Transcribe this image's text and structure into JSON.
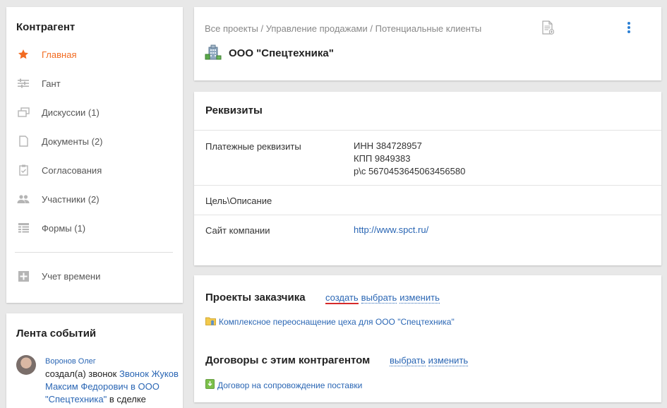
{
  "sidebar": {
    "title": "Контрагент",
    "items": [
      {
        "label": "Главная",
        "icon": "star-icon"
      },
      {
        "label": "Гант",
        "icon": "sliders-icon"
      },
      {
        "label": "Дискуссии (1)",
        "icon": "chat-icon"
      },
      {
        "label": "Документы (2)",
        "icon": "document-icon"
      },
      {
        "label": "Согласования",
        "icon": "clipboard-check-icon"
      },
      {
        "label": "Участники (2)",
        "icon": "people-icon"
      },
      {
        "label": "Формы (1)",
        "icon": "form-icon"
      },
      {
        "label": "Учет времени",
        "icon": "plus-box-icon"
      }
    ],
    "accent_color": "#f26b21"
  },
  "feed": {
    "title": "Лента событий",
    "author": "Воронов Олег",
    "text_prefix": "создал(а) звонок ",
    "link": "Звонок Жуков Максим Федорович в ООО \"Спецтехника\"",
    "text_suffix": " в сделке"
  },
  "header": {
    "breadcrumb": [
      "Все проекты",
      "Управление продажами",
      "Потенциальные клиенты"
    ],
    "separator": " / ",
    "title": "ООО \"Спецтехника\""
  },
  "requisites": {
    "title": "Реквизиты",
    "rows": [
      {
        "key": "Платежные реквизиты",
        "lines": [
          "ИНН 384728957",
          "КПП 9849383",
          "р\\с 5670453645063456580"
        ]
      },
      {
        "key": "Цель\\Описание",
        "lines": []
      },
      {
        "key": "Сайт компании",
        "link": "http://www.spct.ru/"
      }
    ]
  },
  "projects": {
    "title": "Проекты заказчика",
    "actions": [
      "создать",
      "выбрать",
      "изменить"
    ],
    "item": "Комплексное переоснащение цеха для ООО \"Спецтехника\""
  },
  "contracts": {
    "title": "Договоры с этим контрагентом",
    "actions": [
      "выбрать",
      "изменить"
    ],
    "item": "Договор на сопровождение поставки"
  },
  "link_color": "#2a66b4"
}
